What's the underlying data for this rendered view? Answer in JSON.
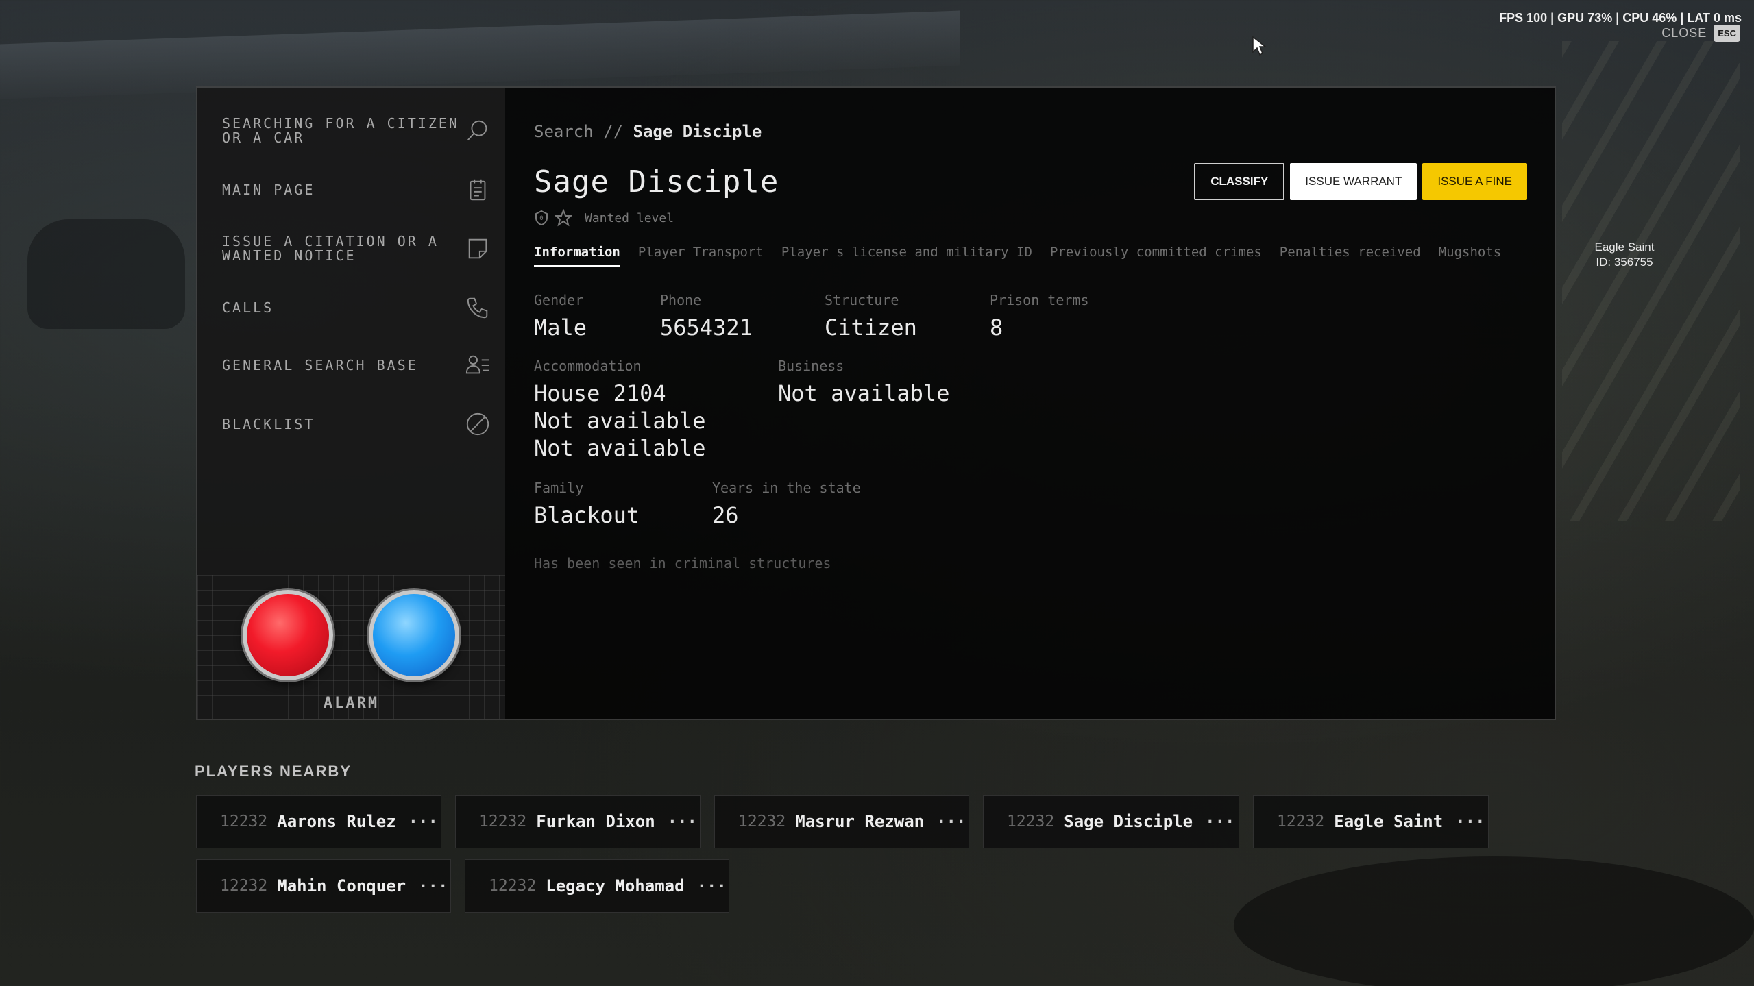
{
  "hud": {
    "text": "FPS 100  |  GPU 73%  |  CPU 46%  |  LAT 0 ms"
  },
  "close": {
    "label": "CLOSE",
    "key": "ESC"
  },
  "overhead_tag": {
    "name": "Eagle Saint",
    "id": "ID: 356755"
  },
  "sidebar": {
    "items": [
      {
        "label": "SEARCHING FOR A CITIZEN\nOR A CAR",
        "icon": "search-icon"
      },
      {
        "label": "MAIN PAGE",
        "icon": "clipboard-icon"
      },
      {
        "label": "ISSUE A CITATION OR A\nWANTED NOTICE",
        "icon": "note-icon"
      },
      {
        "label": "CALLS",
        "icon": "phone-icon"
      },
      {
        "label": "GENERAL SEARCH BASE",
        "icon": "user-list-icon"
      },
      {
        "label": "BLACKLIST",
        "icon": "ban-icon"
      }
    ],
    "alarm_label": "ALARM"
  },
  "content": {
    "breadcrumb": {
      "root": "Search",
      "separator": "//",
      "current": "Sage Disciple"
    },
    "name": "Sage Disciple",
    "wanted_level": {
      "value": 0,
      "label": "Wanted level"
    },
    "actions": {
      "classify": "CLASSIFY",
      "warrant": "ISSUE WARRANT",
      "fine": "ISSUE A FINE"
    },
    "tabs": [
      "Information",
      "Player Transport",
      "Player s license and military ID",
      "Previously committed crimes",
      "Penalties received",
      "Mugshots"
    ],
    "info": {
      "gender": {
        "label": "Gender",
        "value": "Male"
      },
      "phone": {
        "label": "Phone",
        "value": "5654321"
      },
      "structure": {
        "label": "Structure",
        "value": "Citizen"
      },
      "prison": {
        "label": "Prison terms",
        "value": "8"
      },
      "accommodation": {
        "label": "Accommodation",
        "values": [
          "House 2104",
          "Not available",
          "Not available"
        ]
      },
      "business": {
        "label": "Business",
        "value": "Not available"
      },
      "family": {
        "label": "Family",
        "value": "Blackout"
      },
      "years": {
        "label": "Years in the state",
        "value": "26"
      },
      "note": "Has been seen in criminal structures"
    }
  },
  "players_nearby": {
    "title": "PLAYERS NEARBY",
    "players": [
      {
        "id": "12232",
        "name": "Aarons Rulez"
      },
      {
        "id": "12232",
        "name": "Furkan Dixon"
      },
      {
        "id": "12232",
        "name": "Masrur Rezwan"
      },
      {
        "id": "12232",
        "name": "Sage Disciple"
      },
      {
        "id": "12232",
        "name": "Eagle Saint"
      },
      {
        "id": "12232",
        "name": "Mahin Conquer"
      },
      {
        "id": "12232",
        "name": "Legacy Mohamad"
      }
    ],
    "more_glyph": "···"
  },
  "colors": {
    "fine_button": "#f5c800",
    "alarm_red": "#f21b2a",
    "alarm_blue": "#1f9cf3"
  }
}
